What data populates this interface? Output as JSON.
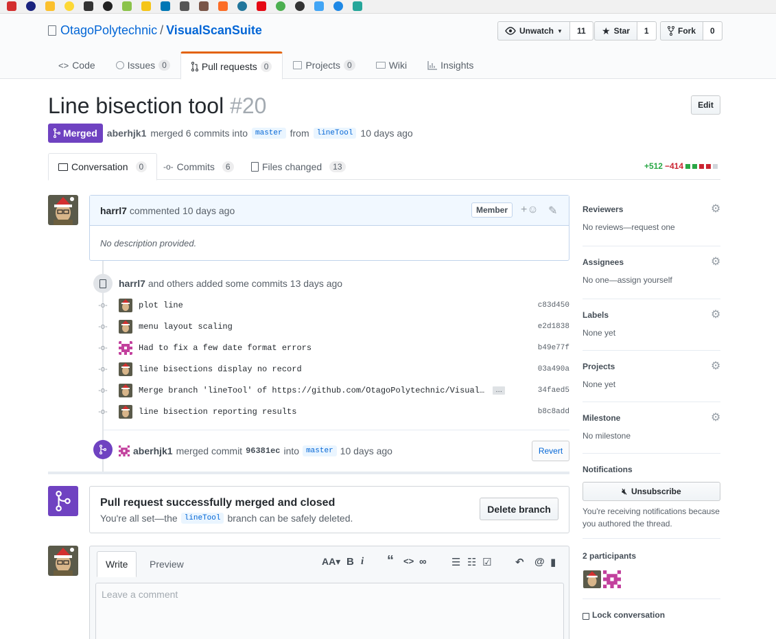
{
  "repo": {
    "owner": "OtagoPolytechnic",
    "separator": "/",
    "name": "VisualScanSuite",
    "watch": {
      "label": "Unwatch",
      "count": "11"
    },
    "star": {
      "label": "Star",
      "count": "1"
    },
    "fork": {
      "label": "Fork",
      "count": "0"
    }
  },
  "nav": [
    {
      "label": "Code",
      "icon": "code-icon"
    },
    {
      "label": "Issues",
      "count": "0",
      "icon": "issue-icon"
    },
    {
      "label": "Pull requests",
      "count": "0",
      "icon": "pull-request-icon"
    },
    {
      "label": "Projects",
      "count": "0",
      "icon": "project-icon"
    },
    {
      "label": "Wiki",
      "icon": "book-icon"
    },
    {
      "label": "Insights",
      "icon": "graph-icon"
    }
  ],
  "pr": {
    "title": "Line bisection tool",
    "number": "#20",
    "edit_label": "Edit",
    "state": "Merged",
    "author": "aberhjk1",
    "merged_text": "merged 6 commits into",
    "base_branch": "master",
    "from_text": "from",
    "head_branch": "lineTool",
    "time": "10 days ago"
  },
  "tabs": {
    "conversation": {
      "label": "Conversation",
      "count": "0"
    },
    "commits": {
      "label": "Commits",
      "count": "6"
    },
    "files": {
      "label": "Files changed",
      "count": "13"
    },
    "additions": "+512",
    "deletions": "−414",
    "colors": {
      "add": "#28a745",
      "del": "#cb2431",
      "neutral": "#d1d5da"
    }
  },
  "comment": {
    "author": "harrl7",
    "action": "commented 10 days ago",
    "badge": "Member",
    "body": "No description provided."
  },
  "commits_event": {
    "author": "harrl7",
    "text": "and others added some commits 13 days ago",
    "items": [
      {
        "message": "plot line",
        "sha": "c83d450"
      },
      {
        "message": "menu layout scaling",
        "sha": "e2d1838"
      },
      {
        "message": "Had to fix a few date format errors",
        "sha": "b49e77f"
      },
      {
        "message": "line bisections display no record",
        "sha": "03a490a"
      },
      {
        "message": "Merge branch 'lineTool' of https://github.com/OtagoPolytechnic/Visual…",
        "sha": "34faed5",
        "ellipsis": "…"
      },
      {
        "message": "line bisection reporting results",
        "sha": "b8c8add"
      }
    ]
  },
  "merge_event": {
    "author": "aberhjk1",
    "text1": "merged commit",
    "commit": "96381ec",
    "text2": "into",
    "branch": "master",
    "time": "10 days ago",
    "revert_label": "Revert"
  },
  "merged_box": {
    "title": "Pull request successfully merged and closed",
    "text_before": "You're all set—the",
    "branch": "lineTool",
    "text_after": "branch can be safely deleted.",
    "delete_label": "Delete branch"
  },
  "editor": {
    "write_tab": "Write",
    "preview_tab": "Preview",
    "placeholder": "Leave a comment"
  },
  "sidebar": {
    "reviewers": {
      "title": "Reviewers",
      "value": "No reviews—request one"
    },
    "assignees": {
      "title": "Assignees",
      "value": "No one—assign yourself"
    },
    "labels": {
      "title": "Labels",
      "value": "None yet"
    },
    "projects": {
      "title": "Projects",
      "value": "None yet"
    },
    "milestone": {
      "title": "Milestone",
      "value": "No milestone"
    },
    "notifications": {
      "title": "Notifications",
      "button": "Unsubscribe",
      "reason": "You're receiving notifications because you authored the thread."
    },
    "participants": "2 participants",
    "lock": "Lock conversation"
  },
  "accent": {
    "link": "#0366d6",
    "merged": "#6f42c1",
    "nav_underline": "#e36209"
  }
}
